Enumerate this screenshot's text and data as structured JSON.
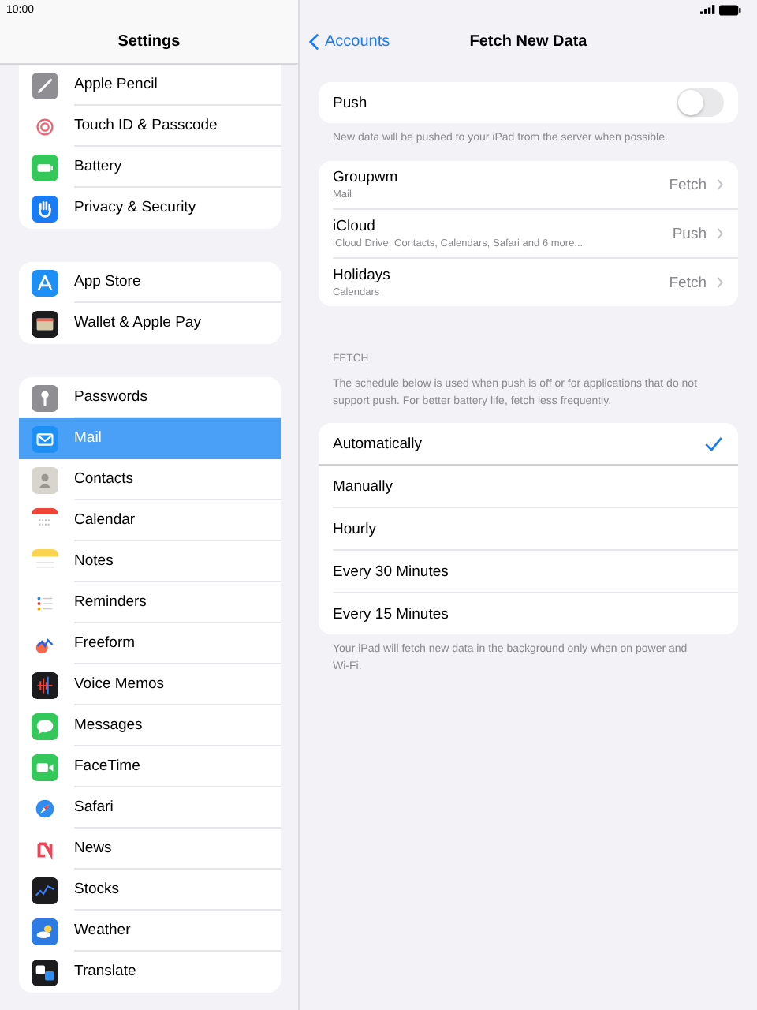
{
  "status_bar": {
    "time": "10:00"
  },
  "sidebar": {
    "title": "Settings",
    "groups": [
      {
        "items": [
          {
            "label": "Apple Pencil",
            "selected": false
          },
          {
            "label": "Touch ID & Passcode",
            "selected": false
          },
          {
            "label": "Battery",
            "selected": false
          },
          {
            "label": "Privacy & Security",
            "selected": false
          }
        ]
      },
      {
        "items": [
          {
            "label": "App Store",
            "selected": false
          },
          {
            "label": "Wallet & Apple Pay",
            "selected": false
          }
        ]
      },
      {
        "items": [
          {
            "label": "Passwords",
            "selected": false
          },
          {
            "label": "Mail",
            "selected": true
          },
          {
            "label": "Contacts",
            "selected": false
          },
          {
            "label": "Calendar",
            "selected": false
          },
          {
            "label": "Notes",
            "selected": false
          },
          {
            "label": "Reminders",
            "selected": false
          },
          {
            "label": "Freeform",
            "selected": false
          },
          {
            "label": "Voice Memos",
            "selected": false
          },
          {
            "label": "Messages",
            "selected": false
          },
          {
            "label": "FaceTime",
            "selected": false
          },
          {
            "label": "Safari",
            "selected": false
          },
          {
            "label": "News",
            "selected": false
          },
          {
            "label": "Stocks",
            "selected": false
          },
          {
            "label": "Weather",
            "selected": false
          },
          {
            "label": "Translate",
            "selected": false
          }
        ]
      }
    ]
  },
  "detail": {
    "back": "Accounts",
    "title": "Fetch New Data",
    "push": {
      "label": "Push",
      "on": false,
      "footnote": "New data will be pushed to your iPad from the server when possible."
    },
    "accounts": [
      {
        "name": "Groupwm",
        "detail": "Mail",
        "value": "Fetch"
      },
      {
        "name": "iCloud",
        "detail": "iCloud Drive, Contacts, Calendars, Safari and 6 more...",
        "value": "Push"
      },
      {
        "name": "Holidays",
        "detail": "Calendars",
        "value": "Fetch"
      }
    ],
    "fetch": {
      "header": "FETCH",
      "description": "The schedule below is used when push is off or for applications that do not support push. For better battery life, fetch less frequently.",
      "options": [
        {
          "label": "Automatically",
          "selected": true
        },
        {
          "label": "Manually",
          "selected": false
        },
        {
          "label": "Hourly",
          "selected": false
        },
        {
          "label": "Every 30 Minutes",
          "selected": false
        },
        {
          "label": "Every 15 Minutes",
          "selected": false
        }
      ],
      "footer": "Your iPad will fetch new data in the background only when on power and Wi-Fi."
    }
  }
}
